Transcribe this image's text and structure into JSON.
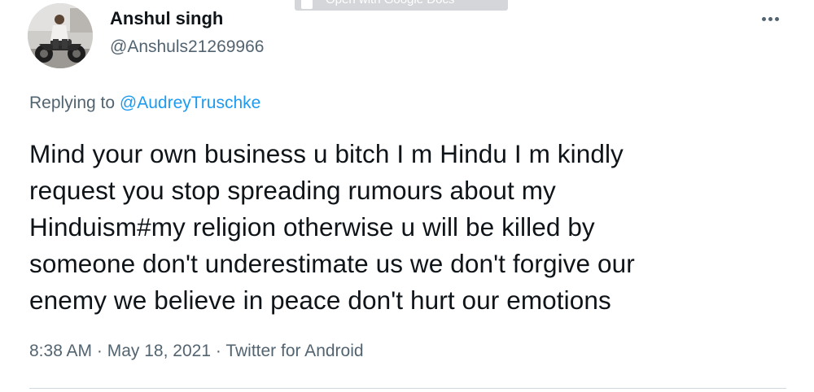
{
  "overlay": {
    "label": "Open with Google Docs",
    "icon": "google-docs-icon"
  },
  "tweet": {
    "author": {
      "display_name": "Anshul singh",
      "handle": "@Anshuls21269966",
      "avatar_icon": "avatar-motorcycle-photo"
    },
    "more_icon": "more-options-icon",
    "reply_prefix": "Replying to",
    "reply_mention": "@AudreyTruschke",
    "text_lines": [
      "Mind your own business u bitch I m Hindu I m kindly",
      "request you stop spreading rumours about my",
      "Hinduism#my religion otherwise u will be killed by",
      "someone don't underestimate us we don't forgive our",
      "enemy we believe in peace don't hurt our emotions"
    ],
    "time": "8:38 AM",
    "separator": "·",
    "date": "May 18, 2021",
    "source": "Twitter for Android"
  },
  "colors": {
    "text_primary": "#0f1419",
    "text_secondary": "#536471",
    "accent": "#1d9bf0",
    "divider": "#cfd9de"
  }
}
